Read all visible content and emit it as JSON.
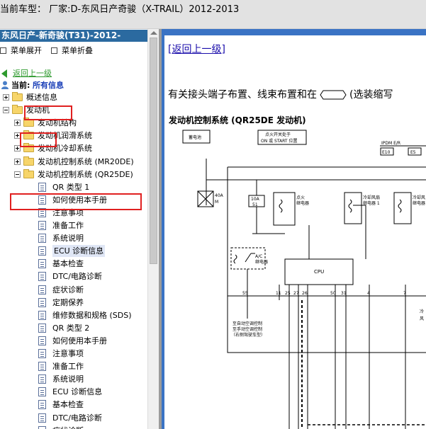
{
  "header": {
    "text": "当前车型： 厂家:D-东风日产奇骏（X-TRAIL）2012-2013"
  },
  "sidebar": {
    "title": "东风日产-新奇骏(T31)-2012-",
    "menu_expand": "菜单展开",
    "menu_collapse": "菜单折叠",
    "back": "返回上一级",
    "current_prefix": "当前:",
    "current_value": "所有信息",
    "tree": [
      {
        "label": "概述信息",
        "toggle": "plus",
        "kind": "folder",
        "level": 0
      },
      {
        "label": "发动机",
        "toggle": "minus",
        "kind": "folder",
        "level": 0
      },
      {
        "label": "发动机结构",
        "toggle": "plus",
        "kind": "folder",
        "level": 1
      },
      {
        "label": "发动机润滑系统",
        "toggle": "plus",
        "kind": "folder",
        "level": 1
      },
      {
        "label": "发动机冷却系统",
        "toggle": "plus",
        "kind": "folder",
        "level": 1
      },
      {
        "label": "发动机控制系统 (MR20DE)",
        "toggle": "plus",
        "kind": "folder",
        "level": 1
      },
      {
        "label": "发动机控制系统 (QR25DE)",
        "toggle": "minus",
        "kind": "folder",
        "level": 1
      },
      {
        "label": "QR 类型 1",
        "kind": "doc",
        "level": 2
      },
      {
        "label": "如何使用本手册",
        "kind": "doc",
        "level": 2
      },
      {
        "label": "注意事项",
        "kind": "doc",
        "level": 2
      },
      {
        "label": "准备工作",
        "kind": "doc",
        "level": 2
      },
      {
        "label": "系统说明",
        "kind": "doc",
        "level": 2
      },
      {
        "label": "ECU 诊断信息",
        "kind": "doc",
        "level": 2,
        "selected": true
      },
      {
        "label": "基本检查",
        "kind": "doc",
        "level": 2
      },
      {
        "label": "DTC/电路诊断",
        "kind": "doc",
        "level": 2
      },
      {
        "label": "症状诊断",
        "kind": "doc",
        "level": 2
      },
      {
        "label": "定期保养",
        "kind": "doc",
        "level": 2
      },
      {
        "label": "维修数据和规格 (SDS)",
        "kind": "doc",
        "level": 2
      },
      {
        "label": "QR 类型 2",
        "kind": "doc",
        "level": 2
      },
      {
        "label": "如何使用本手册",
        "kind": "doc",
        "level": 2
      },
      {
        "label": "注意事项",
        "kind": "doc",
        "level": 2
      },
      {
        "label": "准备工作",
        "kind": "doc",
        "level": 2
      },
      {
        "label": "系统说明",
        "kind": "doc",
        "level": 2
      },
      {
        "label": "ECU 诊断信息",
        "kind": "doc",
        "level": 2
      },
      {
        "label": "基本检查",
        "kind": "doc",
        "level": 2
      },
      {
        "label": "DTC/电路诊断",
        "kind": "doc",
        "level": 2
      },
      {
        "label": "症状诊断",
        "kind": "doc",
        "level": 2
      }
    ]
  },
  "content": {
    "back_link": "[返回上一级]",
    "desc_before": "有关接头端子布置、线束布置和在",
    "desc_after": "(选装缩写",
    "section_title": "发动机控制系统 (QR25DE 发动机)",
    "diagram": {
      "battery": "蓄电池",
      "ign_switch_1": "点火开关处于",
      "ign_switch_2": "ON 或 START 位置",
      "ipdm": "IPDM E/R",
      "e10": "E10",
      "e5": "E5",
      "fuse_40a_1": "40A",
      "fuse_40a_2": "M",
      "fuse_10a_1": "10A",
      "fuse_10a_2": "51",
      "relay_ign_1": "点火",
      "relay_ign_2": "继电器",
      "relay_fan1_1": "冷却风扇",
      "relay_fan1_2": "继电器 1",
      "relay_fan2_1": "冷却风",
      "relay_fan2_2": "继电器",
      "ac_relay_1": "A/C",
      "ac_relay_2": "继电器",
      "cpu": "CPU",
      "pin_55": "55",
      "pin_11": "11",
      "pin_25": "25",
      "pin_27": "27",
      "pin_26": "26",
      "pin_50": "50",
      "pin_31": "31",
      "pin_4": "4",
      "pin_7": "7",
      "note_1": "至自动空调控制",
      "note_2": "至手动空调控制",
      "note_3": "（右侧驾驶车型）",
      "side_1": "冷",
      "side_2": "风"
    }
  }
}
